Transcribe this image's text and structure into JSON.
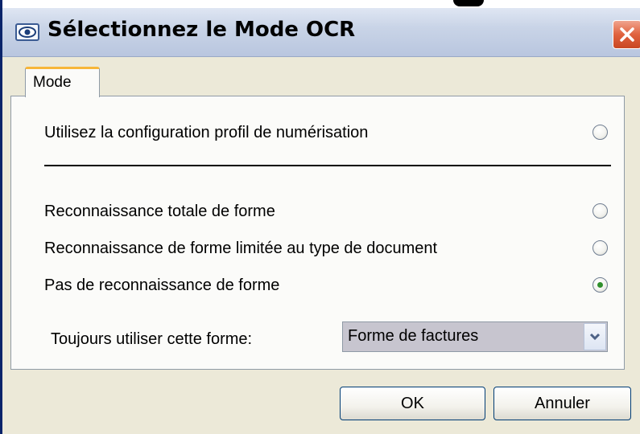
{
  "window": {
    "title": "Sélectionnez le Mode OCR",
    "icon": "eye-scanner-icon",
    "close_icon": "close-icon"
  },
  "tabs": [
    {
      "label": "Mode",
      "selected": true
    }
  ],
  "options": {
    "profile_config": {
      "label": "Utilisez la configuration profil de numérisation",
      "checked": false
    },
    "full_recognition": {
      "label": "Reconnaissance totale de forme",
      "checked": false
    },
    "limited_recognition": {
      "label": "Reconnaissance de forme limitée au type de document",
      "checked": false
    },
    "no_recognition": {
      "label": "Pas de reconnaissance de forme",
      "checked": true
    }
  },
  "form_select": {
    "label": "Toujours utiliser cette forme:",
    "value": "Forme de factures",
    "arrow_icon": "chevron-down-icon"
  },
  "buttons": {
    "ok": "OK",
    "cancel": "Annuler"
  },
  "colors": {
    "titlebar": "#c9d4e7",
    "tab_accent": "#f7b638",
    "close_button": "#e0623e",
    "radio_selected": "#2f8f2b",
    "window_background": "#ece9d8"
  }
}
